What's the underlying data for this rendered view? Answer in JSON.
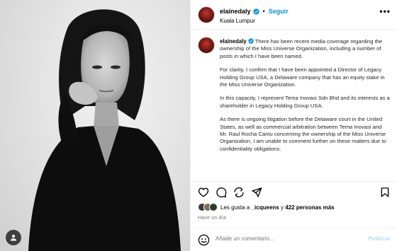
{
  "post": {
    "username": "elainedaly",
    "follow_label": "Seguir",
    "location": "Kuala Lumpur",
    "more_label": "•••"
  },
  "caption": {
    "username": "elainedaly",
    "paragraphs": [
      "There has been recent media coverage regarding the ownership of the Miss Universe Organization, including a number of posts in which I have been named.",
      "For clarity, I confirm that I have been appointed a Director of Legacy Holding Group USA, a Delaware company that has an equity stake in the Miss Universe Organization.",
      "In this capacity, I represent Tema Inovasi Sdn Bhd and its interests as a shareholder in Legacy Holding Group USA.",
      "As there is ongoing litigation before the Delaware court in the United States, as well as commercial arbitration between Tema Inovasi and Mr. Raul Rocha Cantu concerning the ownership of the Miss Universe Organization, I am unable to comment further on these matters due to confidentiality obligations."
    ]
  },
  "likes": {
    "prefix": "Les gusta a",
    "user": "_icqueens",
    "middle": "y",
    "count": "422 personas más"
  },
  "time": "Hace un día",
  "comment": {
    "placeholder": "Añade un comentario...",
    "publish_label": "Publicar"
  },
  "colors": {
    "accent": "#0095f6",
    "publish_disabled": "#b2dffc",
    "verified": "#0095f6"
  },
  "icons": [
    "verified-badge-icon",
    "heart-icon",
    "comment-icon",
    "share-icon",
    "bookmark-icon",
    "emoji-icon",
    "tag-person-icon"
  ]
}
